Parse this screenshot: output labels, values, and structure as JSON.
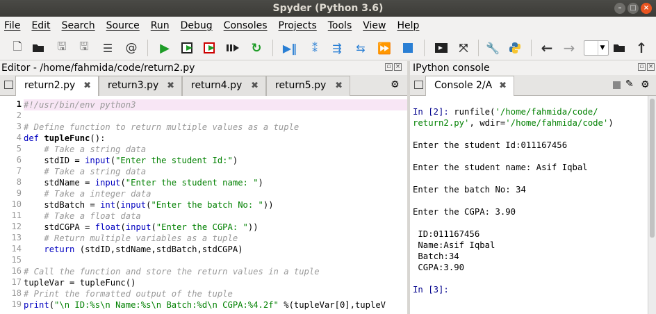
{
  "window": {
    "title": "Spyder (Python 3.6)"
  },
  "menu": [
    "File",
    "Edit",
    "Search",
    "Source",
    "Run",
    "Debug",
    "Consoles",
    "Projects",
    "Tools",
    "View",
    "Help"
  ],
  "editor": {
    "header": "Editor - /home/fahmida/code/return2.py",
    "tabs": [
      "return2.py",
      "return3.py",
      "return4.py",
      "return5.py"
    ],
    "lines": [
      "#!/usr/bin/env python3",
      "",
      "# Define function to return multiple values as a tuple",
      "def tupleFunc():",
      "    # Take a string data",
      "    stdID = input(\"Enter the student Id:\")",
      "    # Take a string data",
      "    stdName = input(\"Enter the student name: \")",
      "    # Take a integer data",
      "    stdBatch = int(input(\"Enter the batch No: \"))",
      "    # Take a float data",
      "    stdCGPA = float(input(\"Enter the CGPA: \"))",
      "    # Return multiple variables as a tuple",
      "    return (stdID,stdName,stdBatch,stdCGPA)",
      "",
      "# Call the function and store the return values in a tuple",
      "tupleVar = tupleFunc()",
      "# Print the formatted output of the tuple",
      "print(\"\\n ID:%s\\n Name:%s\\n Batch:%d\\n CGPA:%4.2f\" %(tupleVar[0],tupleV"
    ]
  },
  "console": {
    "header": "IPython console",
    "tab": "Console 2/A",
    "lines": [
      "In [2]: runfile('/home/fahmida/code/",
      "return2.py', wdir='/home/fahmida/code')",
      "",
      "Enter the student Id:011167456",
      "",
      "Enter the student name: Asif Iqbal",
      "",
      "Enter the batch No: 34",
      "",
      "Enter the CGPA: 3.90",
      "",
      " ID:011167456",
      " Name:Asif Iqbal",
      " Batch:34",
      " CGPA:3.90",
      "",
      "In [3]:"
    ]
  },
  "colors": {
    "comment": "#999999",
    "keyword": "#0000c0",
    "string": "#008000",
    "prompt": "#00008b",
    "highlight": "#f8e6f5"
  }
}
